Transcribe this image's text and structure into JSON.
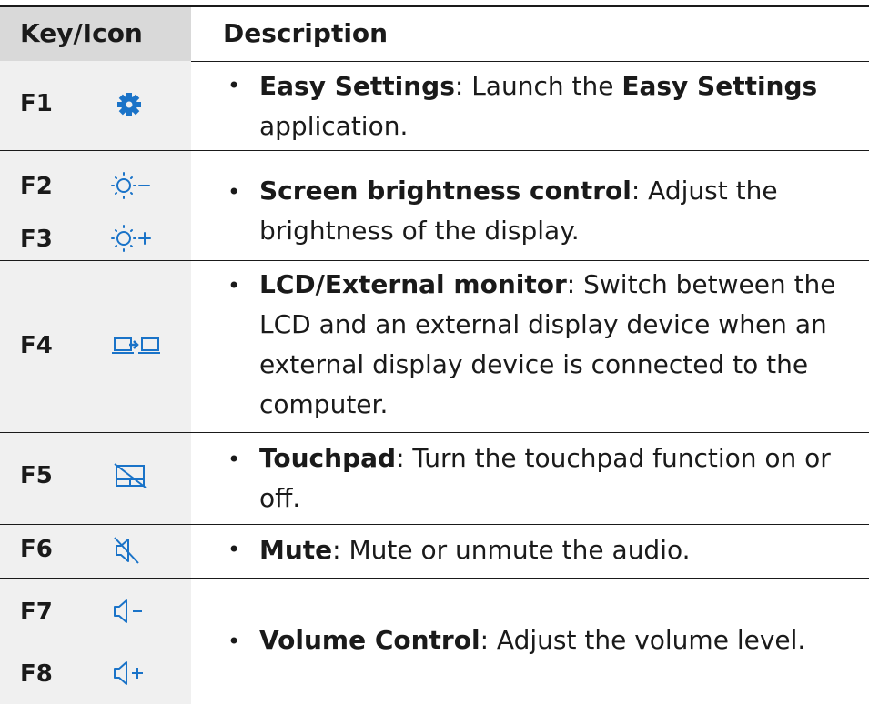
{
  "table": {
    "header": {
      "key": "Key/Icon",
      "description": "Description"
    },
    "bullet": "•",
    "rows": [
      {
        "keys": [
          "F1"
        ],
        "icons": [
          "gear-icon"
        ],
        "bold": "Easy Settings",
        "text1": ": Launch the ",
        "bold2": "Easy Settings",
        "text2": " application."
      },
      {
        "keys": [
          "F2",
          "F3"
        ],
        "icons": [
          "brightness-down-icon",
          "brightness-up-icon"
        ],
        "bold": "Screen brightness control",
        "text1": ": Adjust the brightness of the display."
      },
      {
        "keys": [
          "F4"
        ],
        "icons": [
          "lcd-external-monitor-icon"
        ],
        "bold": "LCD/External monitor",
        "text1": ": Switch between the LCD and an external display device when an external display device is connected to the computer."
      },
      {
        "keys": [
          "F5"
        ],
        "icons": [
          "touchpad-off-icon"
        ],
        "bold": "Touchpad",
        "text1": ": Turn the touchpad function on or off."
      },
      {
        "keys": [
          "F6"
        ],
        "icons": [
          "mute-icon"
        ],
        "bold": "Mute",
        "text1": ": Mute or unmute the audio."
      },
      {
        "keys": [
          "F7",
          "F8"
        ],
        "icons": [
          "volume-down-icon",
          "volume-up-icon"
        ],
        "bold": "Volume Control",
        "text1": ": Adjust the volume level."
      }
    ]
  },
  "colors": {
    "icon": "#1a73c8",
    "keycol": "#f0f0f0",
    "header": "#d9d9d9",
    "text": "#1a1a1a"
  }
}
